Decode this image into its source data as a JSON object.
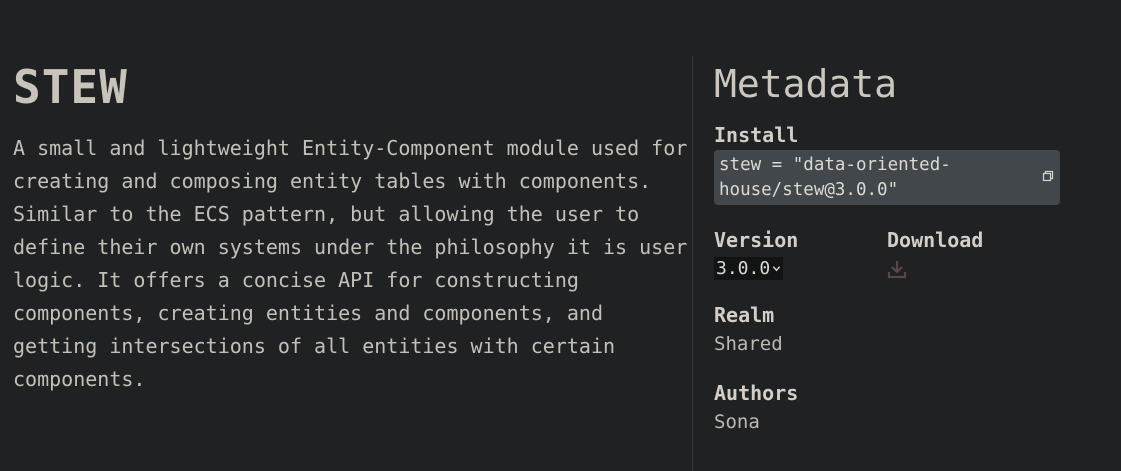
{
  "package": {
    "title": "STEW",
    "description": "A small and lightweight Entity-Component module used for creating and composing entity tables with components. Similar to the ECS pattern, but allowing the user to define their own systems under the philosophy it is user logic. It offers a concise API for constructing components, creating entities and components, and getting intersections of all entities with certain components."
  },
  "metadata": {
    "heading": "Metadata",
    "install_label": "Install",
    "install_line1": "stew = \"data-oriented-",
    "install_line2": "house/stew@3.0.0\"",
    "version_label": "Version",
    "version_value": "3.0.0",
    "download_label": "Download",
    "realm_label": "Realm",
    "realm_value": "Shared",
    "authors_label": "Authors",
    "authors_value": "Sona"
  },
  "icons": {
    "copy": "copy-icon",
    "download": "download-icon",
    "chevron": "chevron-down-icon"
  },
  "colors": {
    "background": "#1f2122",
    "install_box": "#42474b",
    "download_icon": "#5a4548"
  }
}
